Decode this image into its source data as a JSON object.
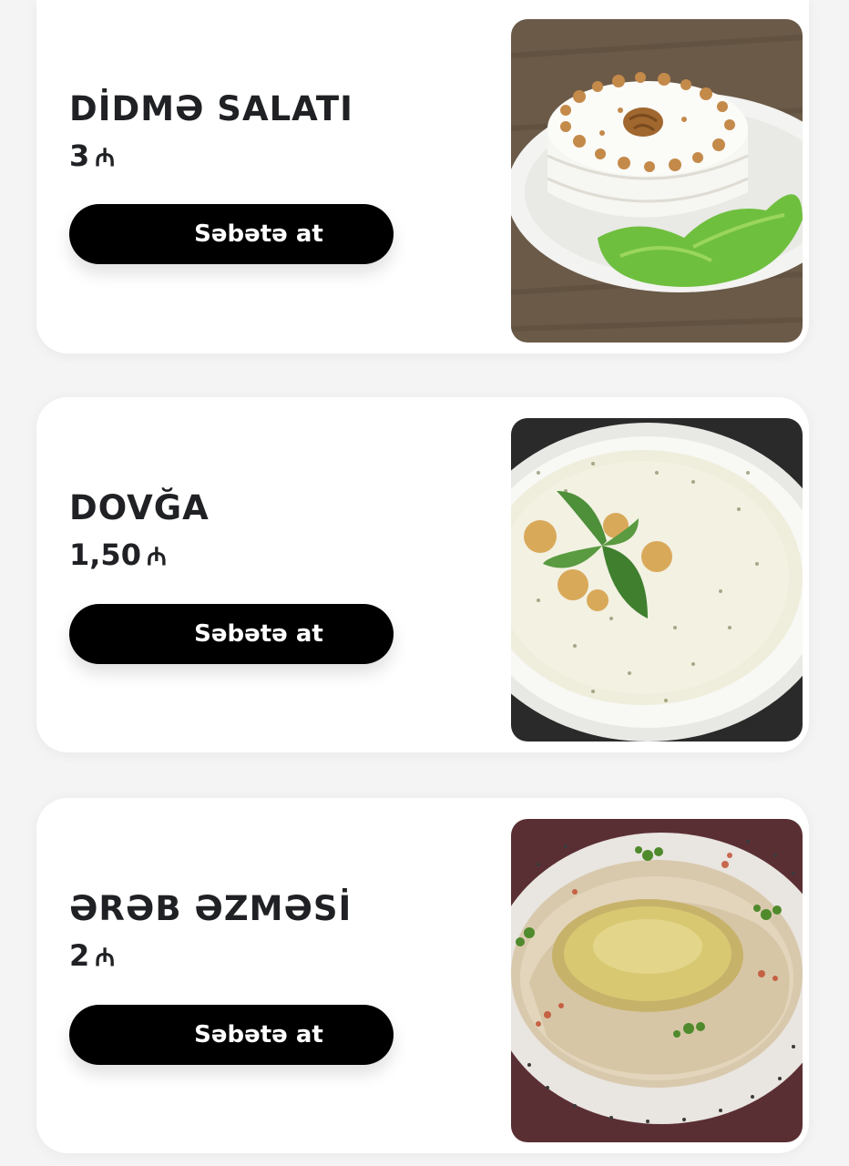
{
  "currency_symbol": "₼",
  "items": [
    {
      "name": "DİDMƏ SALATI",
      "price": "3",
      "button_label": "Səbətə at",
      "image": "didme-salad-photo"
    },
    {
      "name": "DOVĞA",
      "price": "1,50",
      "button_label": "Səbətə at",
      "image": "dovga-soup-photo"
    },
    {
      "name": "ƏRƏB ƏZMƏSİ",
      "price": "2",
      "button_label": "Səbətə at",
      "image": "hummus-photo"
    }
  ]
}
